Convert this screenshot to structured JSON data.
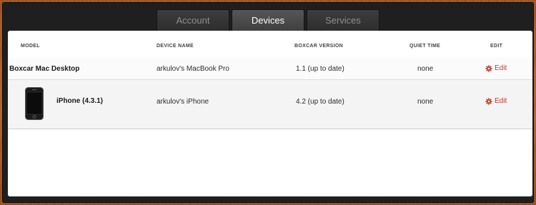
{
  "tabs": [
    {
      "label": "Account",
      "active": false
    },
    {
      "label": "Devices",
      "active": true
    },
    {
      "label": "Services",
      "active": false
    }
  ],
  "table": {
    "headers": {
      "model": "MODEL",
      "device_name": "DEVICE NAME",
      "version": "BOXCAR VERSION",
      "quiet_time": "QUIET TIME",
      "edit": "EDIT"
    },
    "rows": [
      {
        "model": "Boxcar Mac Desktop",
        "device_name": "arkulov's MacBook Pro",
        "version": "1.1 (up to date)",
        "quiet_time": "none",
        "edit": "Edit"
      },
      {
        "model": "iPhone (4.3.1)",
        "device_name": "arkulov's iPhone",
        "version": "4.2 (up to date)",
        "quiet_time": "none",
        "edit": "Edit",
        "icon": "iphone-icon"
      }
    ]
  },
  "colors": {
    "accent_edit": "#c0392b",
    "wood": "#b0602a",
    "frame": "#1f1f1f"
  }
}
